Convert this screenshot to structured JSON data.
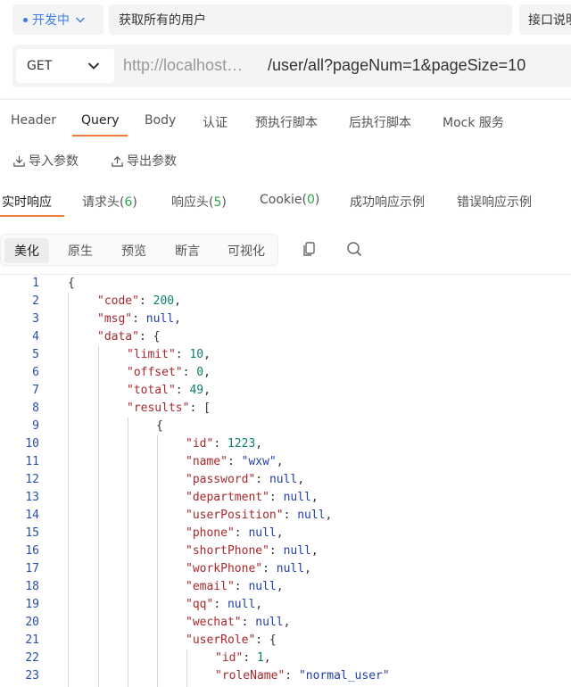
{
  "env": {
    "label": "开发中"
  },
  "api_name": "获取所有的用户",
  "doc_button": "接口说明",
  "method": "GET",
  "url": {
    "prefix": "http://localhost…",
    "path": "/user/all?pageNum=1&pageSize=10"
  },
  "request_tabs": [
    "Header",
    "Query",
    "Body",
    "认证",
    "预执行脚本",
    "后执行脚本",
    "Mock 服务"
  ],
  "import_label": "导入参数",
  "export_label": "导出参数",
  "response_tabs": {
    "realtime": "实时响应",
    "req_headers": "请求头",
    "req_headers_count": "6",
    "res_headers": "响应头",
    "res_headers_count": "5",
    "cookie": "Cookie",
    "cookie_count": "0",
    "success_example": "成功响应示例",
    "error_example": "错误响应示例"
  },
  "view_modes": [
    "美化",
    "原生",
    "预览",
    "断言",
    "可视化"
  ],
  "colors": {
    "accent": "#f07b3f",
    "env_blue": "#3a7ce8",
    "key": "#a8282c",
    "number": "#0a7d6b",
    "null": "#1f3fa8"
  },
  "code_lines": [
    {
      "n": "1",
      "indent": 0,
      "parts": [
        [
          "p",
          "{"
        ]
      ]
    },
    {
      "n": "2",
      "indent": 1,
      "parts": [
        [
          "k",
          "\"code\""
        ],
        [
          "p",
          ": "
        ],
        [
          "num",
          "200"
        ],
        [
          "p",
          ","
        ]
      ]
    },
    {
      "n": "3",
      "indent": 1,
      "parts": [
        [
          "k",
          "\"msg\""
        ],
        [
          "p",
          ": "
        ],
        [
          "nul",
          "null"
        ],
        [
          "p",
          ","
        ]
      ]
    },
    {
      "n": "4",
      "indent": 1,
      "parts": [
        [
          "k",
          "\"data\""
        ],
        [
          "p",
          ": {"
        ]
      ]
    },
    {
      "n": "5",
      "indent": 2,
      "parts": [
        [
          "k",
          "\"limit\""
        ],
        [
          "p",
          ": "
        ],
        [
          "num",
          "10"
        ],
        [
          "p",
          ","
        ]
      ]
    },
    {
      "n": "6",
      "indent": 2,
      "parts": [
        [
          "k",
          "\"offset\""
        ],
        [
          "p",
          ": "
        ],
        [
          "num",
          "0"
        ],
        [
          "p",
          ","
        ]
      ]
    },
    {
      "n": "7",
      "indent": 2,
      "parts": [
        [
          "k",
          "\"total\""
        ],
        [
          "p",
          ": "
        ],
        [
          "num",
          "49"
        ],
        [
          "p",
          ","
        ]
      ]
    },
    {
      "n": "8",
      "indent": 2,
      "parts": [
        [
          "k",
          "\"results\""
        ],
        [
          "p",
          ": ["
        ]
      ]
    },
    {
      "n": "9",
      "indent": 3,
      "parts": [
        [
          "p",
          "{"
        ]
      ]
    },
    {
      "n": "10",
      "indent": 4,
      "parts": [
        [
          "k",
          "\"id\""
        ],
        [
          "p",
          ": "
        ],
        [
          "num",
          "1223"
        ],
        [
          "p",
          ","
        ]
      ]
    },
    {
      "n": "11",
      "indent": 4,
      "parts": [
        [
          "k",
          "\"name\""
        ],
        [
          "p",
          ": "
        ],
        [
          "str",
          "\"wxw\""
        ],
        [
          "p",
          ","
        ]
      ]
    },
    {
      "n": "12",
      "indent": 4,
      "parts": [
        [
          "k",
          "\"password\""
        ],
        [
          "p",
          ": "
        ],
        [
          "nul",
          "null"
        ],
        [
          "p",
          ","
        ]
      ]
    },
    {
      "n": "13",
      "indent": 4,
      "parts": [
        [
          "k",
          "\"department\""
        ],
        [
          "p",
          ": "
        ],
        [
          "nul",
          "null"
        ],
        [
          "p",
          ","
        ]
      ]
    },
    {
      "n": "14",
      "indent": 4,
      "parts": [
        [
          "k",
          "\"userPosition\""
        ],
        [
          "p",
          ": "
        ],
        [
          "nul",
          "null"
        ],
        [
          "p",
          ","
        ]
      ]
    },
    {
      "n": "15",
      "indent": 4,
      "parts": [
        [
          "k",
          "\"phone\""
        ],
        [
          "p",
          ": "
        ],
        [
          "nul",
          "null"
        ],
        [
          "p",
          ","
        ]
      ]
    },
    {
      "n": "16",
      "indent": 4,
      "parts": [
        [
          "k",
          "\"shortPhone\""
        ],
        [
          "p",
          ": "
        ],
        [
          "nul",
          "null"
        ],
        [
          "p",
          ","
        ]
      ]
    },
    {
      "n": "17",
      "indent": 4,
      "parts": [
        [
          "k",
          "\"workPhone\""
        ],
        [
          "p",
          ": "
        ],
        [
          "nul",
          "null"
        ],
        [
          "p",
          ","
        ]
      ]
    },
    {
      "n": "18",
      "indent": 4,
      "parts": [
        [
          "k",
          "\"email\""
        ],
        [
          "p",
          ": "
        ],
        [
          "nul",
          "null"
        ],
        [
          "p",
          ","
        ]
      ]
    },
    {
      "n": "19",
      "indent": 4,
      "parts": [
        [
          "k",
          "\"qq\""
        ],
        [
          "p",
          ": "
        ],
        [
          "nul",
          "null"
        ],
        [
          "p",
          ","
        ]
      ]
    },
    {
      "n": "20",
      "indent": 4,
      "parts": [
        [
          "k",
          "\"wechat\""
        ],
        [
          "p",
          ": "
        ],
        [
          "nul",
          "null"
        ],
        [
          "p",
          ","
        ]
      ]
    },
    {
      "n": "21",
      "indent": 4,
      "parts": [
        [
          "k",
          "\"userRole\""
        ],
        [
          "p",
          ": {"
        ]
      ]
    },
    {
      "n": "22",
      "indent": 5,
      "parts": [
        [
          "k",
          "\"id\""
        ],
        [
          "p",
          ": "
        ],
        [
          "num",
          "1"
        ],
        [
          "p",
          ","
        ]
      ]
    },
    {
      "n": "23",
      "indent": 5,
      "parts": [
        [
          "k",
          "\"roleName\""
        ],
        [
          "p",
          ": "
        ],
        [
          "str",
          "\"normal_user\""
        ]
      ]
    }
  ]
}
